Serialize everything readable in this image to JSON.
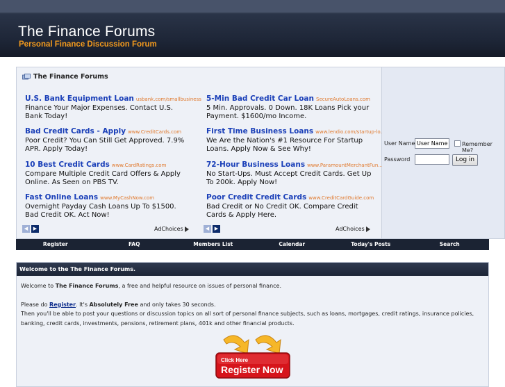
{
  "header": {
    "title": "The Finance Forums",
    "subtitle": "Personal Finance Discussion Forum"
  },
  "panel": {
    "title": "The Finance Forums"
  },
  "ads": [
    {
      "title": "U.S. Bank Equipment Loan",
      "url": "usbank.com/smallbusiness",
      "text": "Finance Your Major Expenses. Contact U.S. Bank Today!"
    },
    {
      "title": "5-Min Bad Credit Car Loan",
      "url": "SecureAutoLoans.com",
      "text": "5 Min. Approvals. 0 Down. 18K Loans Pick your Payment. $1600/mo Income."
    },
    {
      "title": "Bad Credit Cards - Apply",
      "url": "www.CreditCards.com",
      "text": "Poor Credit? You Can Still Get Approved. 7.9% APR. Apply Today!"
    },
    {
      "title": "First Time Business Loans",
      "url": "www.lendio.com/startup-lo...",
      "text": "We Are the Nation's #1 Resource For Startup Loans. Apply Now & See Why!"
    },
    {
      "title": "10 Best Credit Cards",
      "url": "www.CardRatings.com",
      "text": "Compare Multiple Credit Card Offers & Apply Online. As Seen on PBS TV."
    },
    {
      "title": "72-Hour Business Loans",
      "url": "www.ParamountMerchantFun...",
      "text": "No Start-Ups. Must Accept Credit Cards. Get Up To 200k. Apply Now!"
    },
    {
      "title": "Fast Online Loans",
      "url": "www.MyCashNow.com",
      "text": "Overnight Payday Cash Loans Up To $1500. Bad Credit OK. Act Now!"
    },
    {
      "title": "Poor Credit Credit Cards",
      "url": "www.CreditCardGuide.com",
      "text": "Bad Credit or No Credit OK. Compare Credit Cards & Apply Here."
    }
  ],
  "adchoices": "AdChoices",
  "login": {
    "username_label": "User Name",
    "username_value": "User Name",
    "remember_label": "Remember Me?",
    "password_label": "Password",
    "login_button": "Log in"
  },
  "nav": [
    "Register",
    "FAQ",
    "Members List",
    "Calendar",
    "Today's Posts",
    "Search"
  ],
  "welcome": {
    "heading": "Welcome to the The Finance Forums.",
    "p1_pre": "Welcome to ",
    "p1_bold": "The Finance Forums",
    "p1_post": ", a free and helpful resource on issues of personal finance.",
    "p2_pre": "Please do ",
    "p2_link": "Register",
    "p2_mid": ". It's ",
    "p2_bold": "Absolutely Free",
    "p2_post": " and only takes 30 seconds.",
    "p3": "Then you'll be able to post your questions or discussion topics on all sort of personal finance subjects, such as loans, mortgages, credit ratings, insurance policies, banking, credit cards, investments, pensions, retirement plans, 401k and other financial products."
  },
  "register_graphic": {
    "small": "Click Here",
    "big": "Register Now"
  },
  "colors": {
    "accent_orange": "#f39a1d",
    "ad_link": "#1a3fb8",
    "header_dark": "#1d2536"
  }
}
